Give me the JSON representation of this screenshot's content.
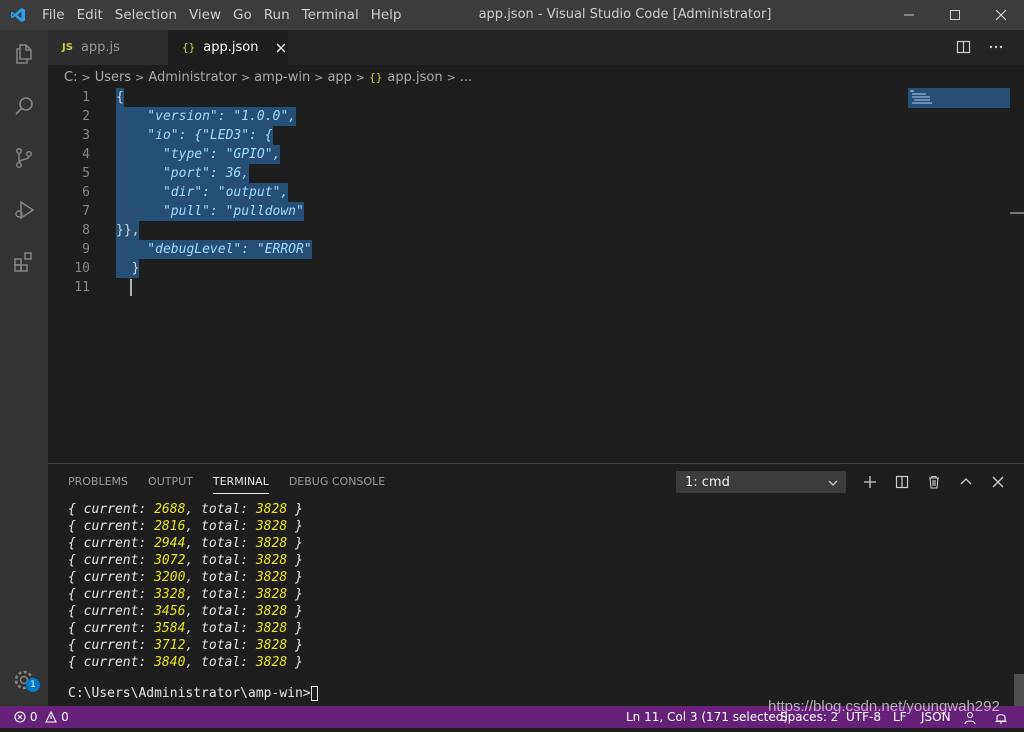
{
  "menu": [
    "File",
    "Edit",
    "Selection",
    "View",
    "Go",
    "Run",
    "Terminal",
    "Help"
  ],
  "window_title": "app.json - Visual Studio Code [Administrator]",
  "tabs": [
    {
      "label": "app.js",
      "icon": "JS"
    },
    {
      "label": "app.json",
      "icon": "{}"
    }
  ],
  "breadcrumb": [
    "C:",
    "Users",
    "Administrator",
    "amp-win",
    "app",
    "app.json",
    "..."
  ],
  "breadcrumb_json_icon": "{}",
  "editor": {
    "line_numbers": [
      "1",
      "2",
      "3",
      "4",
      "5",
      "6",
      "7",
      "8",
      "9",
      "10",
      "11"
    ],
    "lines": [
      "{",
      "    \"version\": \"1.0.0\",",
      "    \"io\": {\"LED3\": {",
      "      \"type\": \"GPIO\",",
      "      \"port\": 36,",
      "      \"dir\": \"output\",",
      "      \"pull\": \"pulldown\"",
      "}},",
      "    \"debugLevel\": \"ERROR\"",
      "  }",
      ""
    ]
  },
  "panel": {
    "tabs": [
      "PROBLEMS",
      "OUTPUT",
      "TERMINAL",
      "DEBUG CONSOLE"
    ],
    "active_tab": "TERMINAL",
    "terminal_select": "1: cmd",
    "terminal_lines": [
      {
        "current": "2688",
        "total": "3828"
      },
      {
        "current": "2816",
        "total": "3828"
      },
      {
        "current": "2944",
        "total": "3828"
      },
      {
        "current": "3072",
        "total": "3828"
      },
      {
        "current": "3200",
        "total": "3828"
      },
      {
        "current": "3328",
        "total": "3828"
      },
      {
        "current": "3456",
        "total": "3828"
      },
      {
        "current": "3584",
        "total": "3828"
      },
      {
        "current": "3712",
        "total": "3828"
      },
      {
        "current": "3840",
        "total": "3828"
      }
    ],
    "prompt": "C:\\Users\\Administrator\\amp-win>"
  },
  "status": {
    "errors": "0",
    "warnings": "0",
    "position": "Ln 11, Col 3 (171 selected)",
    "spaces": "Spaces: 2",
    "encoding": "UTF-8",
    "eol": "LF",
    "language": "JSON"
  },
  "activity_badge": "1",
  "watermark": "https://blog.csdn.net/youngwah292",
  "colors": {
    "statusbar": "#68217a",
    "selection": "#264f78",
    "accent": "#007acc"
  }
}
